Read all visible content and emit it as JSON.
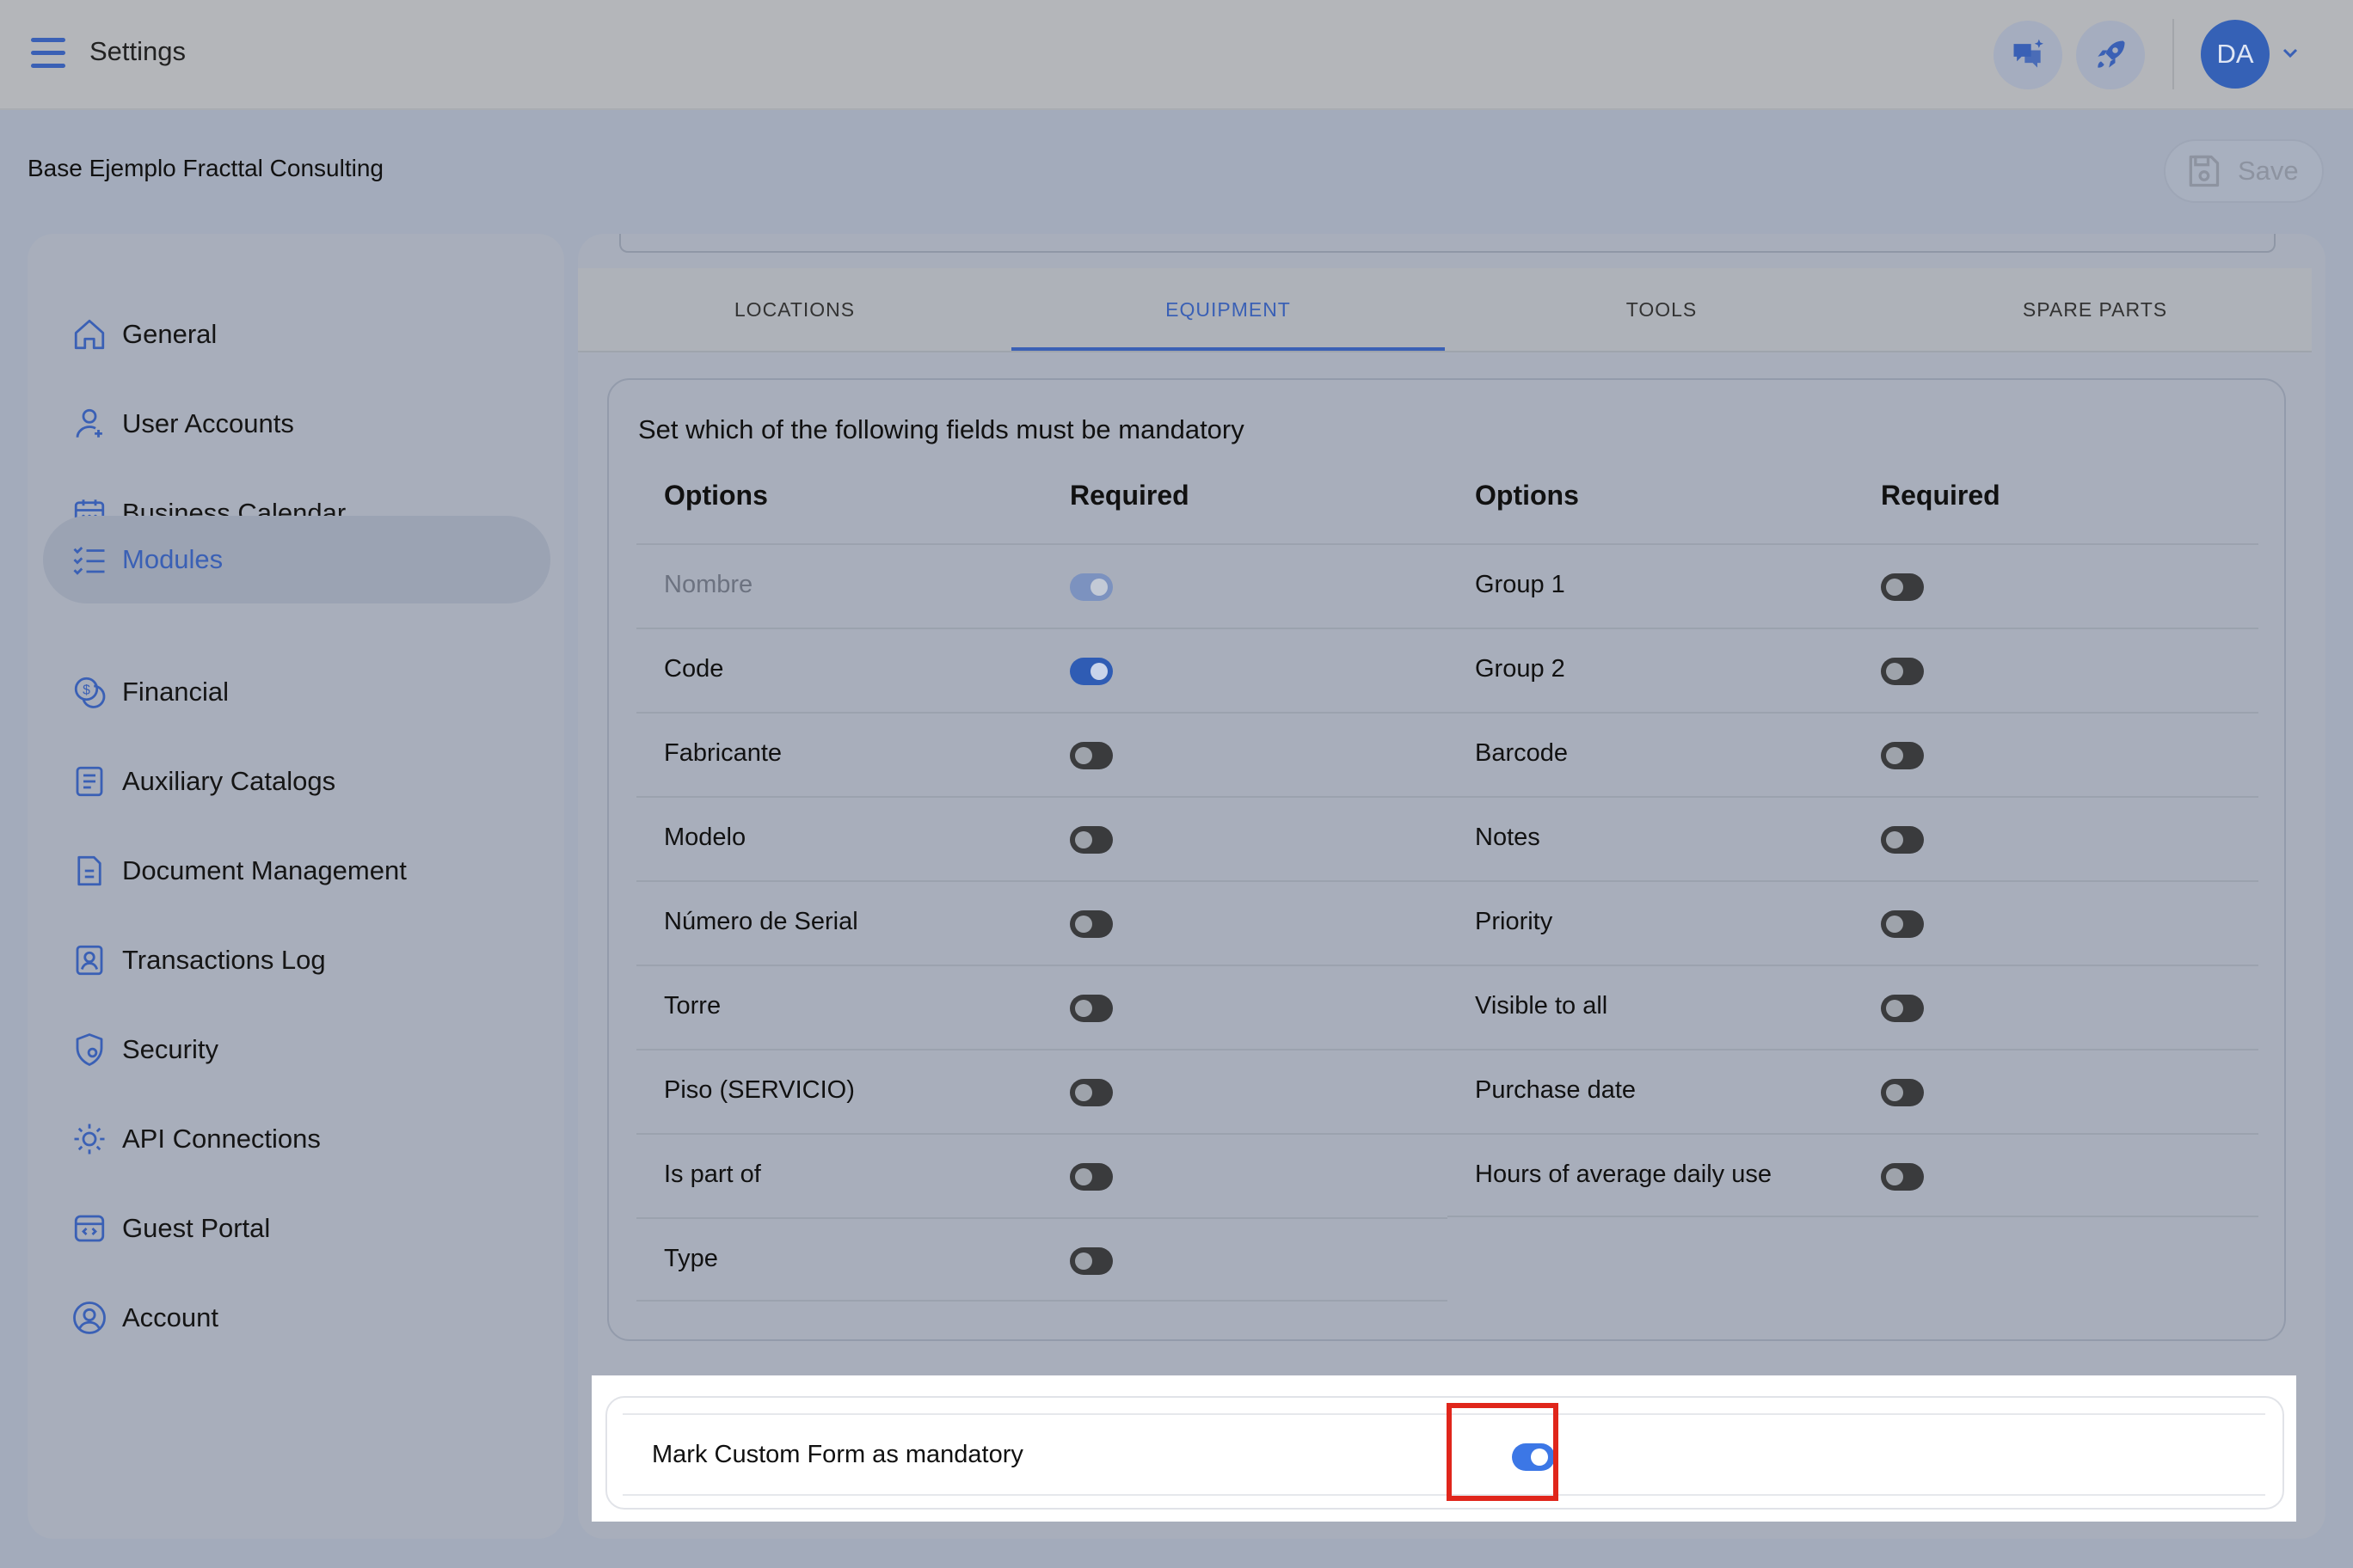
{
  "header": {
    "title": "Settings",
    "avatar_initials": "DA"
  },
  "subheader": {
    "org_name": "Base Ejemplo Fracttal Consulting",
    "save_label": "Save"
  },
  "sidebar": {
    "items": [
      {
        "label": "General",
        "icon": "home-icon"
      },
      {
        "label": "User Accounts",
        "icon": "user-icon"
      },
      {
        "label": "Business Calendar",
        "icon": "calendar-icon"
      },
      {
        "label": "Modules",
        "icon": "checklist-icon",
        "active": true
      },
      {
        "label": "Financial",
        "icon": "coins-icon"
      },
      {
        "label": "Auxiliary Catalogs",
        "icon": "catalog-icon"
      },
      {
        "label": "Document Management",
        "icon": "document-icon"
      },
      {
        "label": "Transactions Log",
        "icon": "log-icon"
      },
      {
        "label": "Security",
        "icon": "shield-icon"
      },
      {
        "label": "API Connections",
        "icon": "api-gear-icon"
      },
      {
        "label": "Guest Portal",
        "icon": "portal-icon"
      },
      {
        "label": "Account",
        "icon": "account-icon"
      }
    ]
  },
  "tabs": [
    {
      "label": "LOCATIONS"
    },
    {
      "label": "EQUIPMENT",
      "active": true
    },
    {
      "label": "TOOLS"
    },
    {
      "label": "SPARE PARTS"
    }
  ],
  "fields": {
    "title": "Set which of the following fields must be mandatory",
    "col_options": "Options",
    "col_required": "Required",
    "left": [
      {
        "label": "Nombre",
        "required": true,
        "disabled": true
      },
      {
        "label": "Code",
        "required": true
      },
      {
        "label": "Fabricante",
        "required": false
      },
      {
        "label": "Modelo",
        "required": false
      },
      {
        "label": "Número de Serial",
        "required": false
      },
      {
        "label": "Torre",
        "required": false
      },
      {
        "label": "Piso (SERVICIO)",
        "required": false
      },
      {
        "label": "Is part of",
        "required": false
      },
      {
        "label": "Type",
        "required": false
      }
    ],
    "right": [
      {
        "label": "Group 1",
        "required": false
      },
      {
        "label": "Group 2",
        "required": false
      },
      {
        "label": "Barcode",
        "required": false
      },
      {
        "label": "Notes",
        "required": false
      },
      {
        "label": "Priority",
        "required": false
      },
      {
        "label": "Visible to all",
        "required": false
      },
      {
        "label": "Purchase date",
        "required": false
      },
      {
        "label": "Hours of average daily use",
        "required": false
      }
    ]
  },
  "custom_form": {
    "label": "Mark Custom Form as mandatory",
    "enabled": true
  },
  "colors": {
    "accent": "#3a60b5",
    "highlight_border": "#e0261b",
    "toggle_on": "#3c77e6"
  }
}
